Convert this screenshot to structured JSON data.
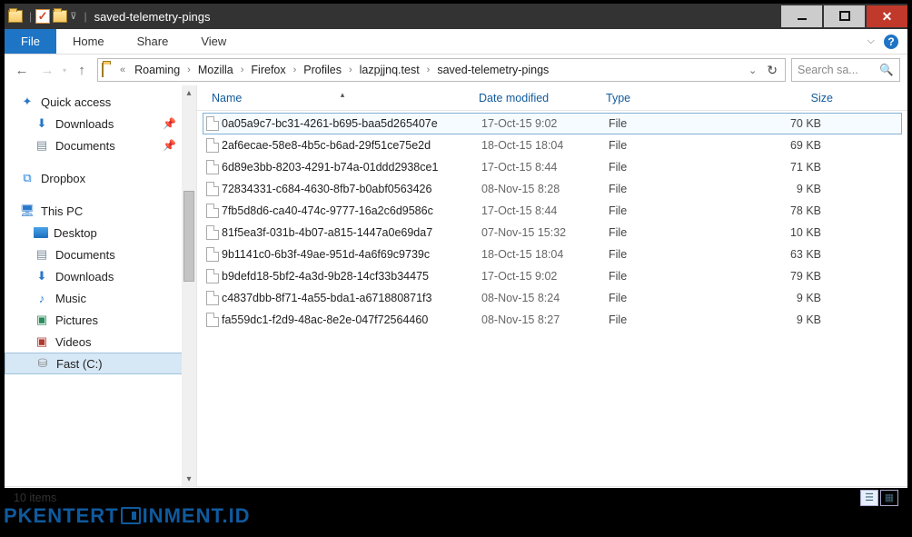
{
  "window": {
    "title": "saved-telemetry-pings"
  },
  "ribbon": {
    "file": "File",
    "tabs": [
      "Home",
      "Share",
      "View"
    ]
  },
  "nav": {
    "back_enabled": true,
    "forward_enabled": false
  },
  "breadcrumb": {
    "items": [
      "Roaming",
      "Mozilla",
      "Firefox",
      "Profiles",
      "lazpjjnq.test",
      "saved-telemetry-pings"
    ]
  },
  "search": {
    "placeholder": "Search sa..."
  },
  "sidebar": {
    "quick_access": "Quick access",
    "qa_items": [
      "Downloads",
      "Documents"
    ],
    "dropbox": "Dropbox",
    "this_pc": "This PC",
    "pc_items": [
      "Desktop",
      "Documents",
      "Downloads",
      "Music",
      "Pictures",
      "Videos",
      "Fast (C:)"
    ]
  },
  "columns": {
    "name": "Name",
    "date": "Date modified",
    "type": "Type",
    "size": "Size"
  },
  "files": [
    {
      "name": "0a05a9c7-bc31-4261-b695-baa5d265407e",
      "date": "17-Oct-15 9:02",
      "type": "File",
      "size": "70 KB",
      "selected": true
    },
    {
      "name": "2af6ecae-58e8-4b5c-b6ad-29f51ce75e2d",
      "date": "18-Oct-15 18:04",
      "type": "File",
      "size": "69 KB"
    },
    {
      "name": "6d89e3bb-8203-4291-b74a-01ddd2938ce1",
      "date": "17-Oct-15 8:44",
      "type": "File",
      "size": "71 KB"
    },
    {
      "name": "72834331-c684-4630-8fb7-b0abf0563426",
      "date": "08-Nov-15 8:28",
      "type": "File",
      "size": "9 KB"
    },
    {
      "name": "7fb5d8d6-ca40-474c-9777-16a2c6d9586c",
      "date": "17-Oct-15 8:44",
      "type": "File",
      "size": "78 KB"
    },
    {
      "name": "81f5ea3f-031b-4b07-a815-1447a0e69da7",
      "date": "07-Nov-15 15:32",
      "type": "File",
      "size": "10 KB"
    },
    {
      "name": "9b1141c0-6b3f-49ae-951d-4a6f69c9739c",
      "date": "18-Oct-15 18:04",
      "type": "File",
      "size": "63 KB"
    },
    {
      "name": "b9defd18-5bf2-4a3d-9b28-14cf33b34475",
      "date": "17-Oct-15 9:02",
      "type": "File",
      "size": "79 KB"
    },
    {
      "name": "c4837dbb-8f71-4a55-bda1-a671880871f3",
      "date": "08-Nov-15 8:24",
      "type": "File",
      "size": "9 KB"
    },
    {
      "name": "fa559dc1-f2d9-48ac-8e2e-047f72564460",
      "date": "08-Nov-15 8:27",
      "type": "File",
      "size": "9 KB"
    }
  ],
  "status": {
    "count": "10 items"
  },
  "watermark": {
    "a": "PKENTERT",
    "b": "INMENT.ID"
  }
}
